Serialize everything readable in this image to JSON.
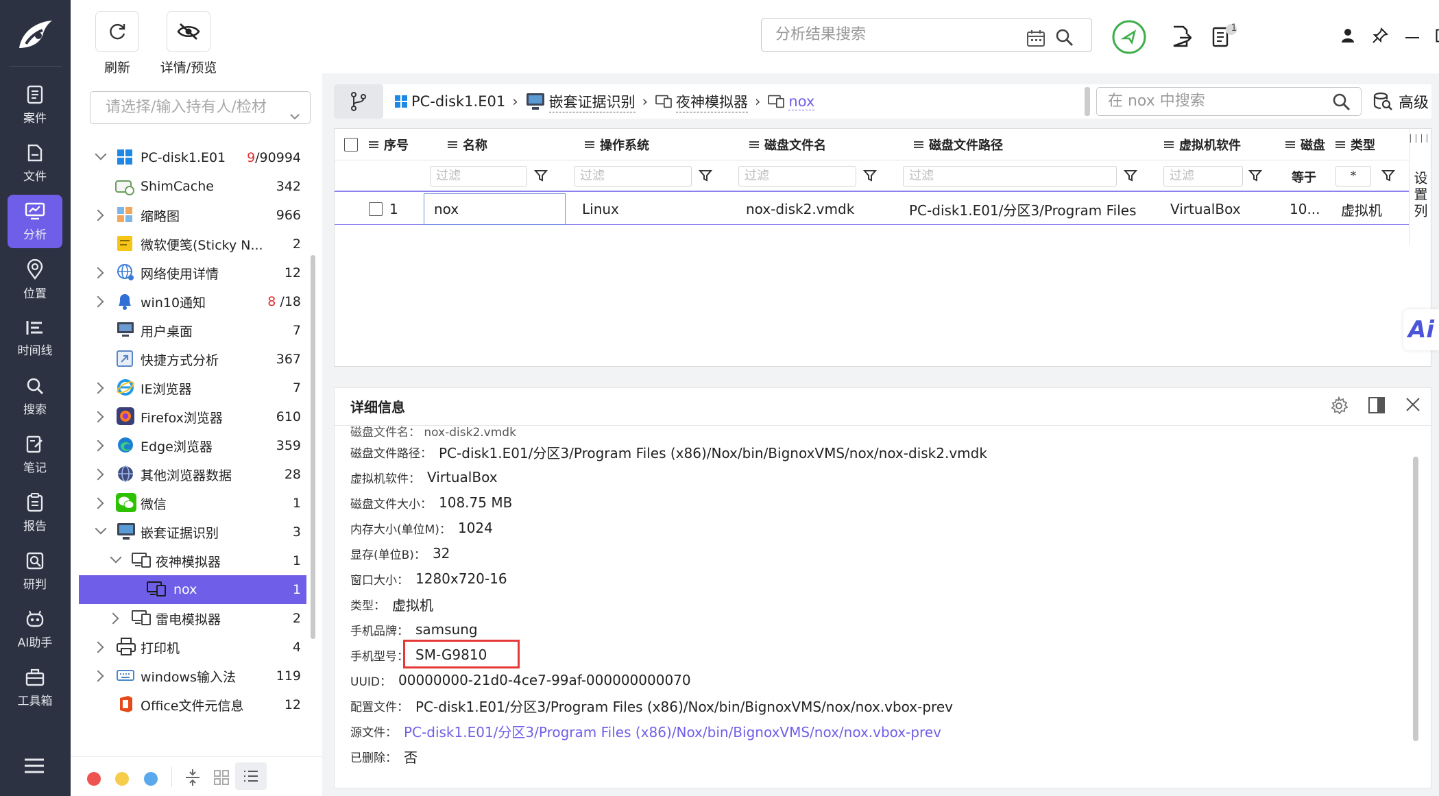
{
  "rail": {
    "items": [
      {
        "label": "案件",
        "icon": "document-icon"
      },
      {
        "label": "文件",
        "icon": "file-icon"
      },
      {
        "label": "分析",
        "icon": "monitor-icon"
      },
      {
        "label": "位置",
        "icon": "location-icon"
      },
      {
        "label": "时间线",
        "icon": "timeline-icon"
      },
      {
        "label": "搜索",
        "icon": "search-icon"
      },
      {
        "label": "笔记",
        "icon": "note-icon"
      },
      {
        "label": "报告",
        "icon": "report-icon"
      },
      {
        "label": "研判",
        "icon": "analysis-icon"
      },
      {
        "label": "AI助手",
        "icon": "robot-icon"
      },
      {
        "label": "工具箱",
        "icon": "toolbox-icon"
      }
    ]
  },
  "toolbar": {
    "refresh_label": "刷新",
    "preview_label": "详情/预览",
    "search_placeholder": "分析结果搜索",
    "badge_count": "1"
  },
  "left": {
    "holder_placeholder": "请选择/输入持有人/检材",
    "tree": [
      {
        "label": "PC-disk1.E01",
        "count_red": "9",
        "count": "/90994",
        "icon": "windows-icon"
      },
      {
        "label": "ShimCache",
        "count": "342",
        "icon": "shimcache-icon"
      },
      {
        "label": "缩略图",
        "count": "966",
        "icon": "thumbnail-icon"
      },
      {
        "label": "微软便笺(Sticky N...",
        "count": "2",
        "icon": "sticky-note-icon"
      },
      {
        "label": "网络使用详情",
        "count": "12",
        "icon": "network-icon"
      },
      {
        "label": "win10通知",
        "count_red": "8",
        "count": " /18",
        "icon": "bell-icon"
      },
      {
        "label": "用户桌面",
        "count": "7",
        "icon": "desktop-icon"
      },
      {
        "label": "快捷方式分析",
        "count": "367",
        "icon": "shortcut-icon"
      },
      {
        "label": "IE浏览器",
        "count": "7",
        "icon": "ie-icon"
      },
      {
        "label": "Firefox浏览器",
        "count": "610",
        "icon": "firefox-icon"
      },
      {
        "label": "Edge浏览器",
        "count": "359",
        "icon": "edge-icon"
      },
      {
        "label": "其他浏览器数据",
        "count": "28",
        "icon": "globe-icon"
      },
      {
        "label": "微信",
        "count": "1",
        "icon": "wechat-icon"
      },
      {
        "label": "嵌套证据识别",
        "count": "3",
        "icon": "nested-evidence-icon"
      },
      {
        "label": "夜神模拟器",
        "count": "1",
        "icon": "emulator-icon"
      },
      {
        "label": "nox",
        "count": "1",
        "icon": "vm-icon"
      },
      {
        "label": "雷电模拟器",
        "count": "2",
        "icon": "emulator-icon"
      },
      {
        "label": "打印机",
        "count": "4",
        "icon": "printer-icon"
      },
      {
        "label": "windows输入法",
        "count": "119",
        "icon": "keyboard-icon"
      },
      {
        "label": "Office文件元信息",
        "count": "12",
        "icon": "office-icon"
      }
    ]
  },
  "breadcrumb": {
    "items": [
      "PC-disk1.E01",
      "嵌套证据识别",
      "夜神模拟器",
      "nox"
    ],
    "search_placeholder": "在 nox 中搜索",
    "advanced_label": "高级"
  },
  "grid": {
    "columns": [
      "序号",
      "名称",
      "操作系统",
      "磁盘文件名",
      "磁盘文件路径",
      "虚拟机软件",
      "磁盘",
      "类型"
    ],
    "filter_placeholder": "过滤",
    "filter_equal": "等于",
    "filter_star": "*",
    "settings_label": "设置列",
    "row": {
      "index": "1",
      "name": "nox",
      "os": "Linux",
      "disk_name": "nox-disk2.vmdk",
      "disk_path": "PC-disk1.E01/分区3/Program Files ...",
      "vm_software": "VirtualBox",
      "disk": "10...",
      "type": "虚拟机"
    },
    "ai_label": "Ai"
  },
  "detail": {
    "title": "详细信息",
    "partial_top": "磁盘文件名：  nox-disk2.vmdk",
    "rows": [
      {
        "key": "磁盘文件路径：",
        "value": "PC-disk1.E01/分区3/Program Files (x86)/Nox/bin/BignoxVMS/nox/nox-disk2.vmdk"
      },
      {
        "key": "虚拟机软件：",
        "value": "VirtualBox"
      },
      {
        "key": "磁盘文件大小：",
        "value": "108.75 MB"
      },
      {
        "key": "内存大小(单位M)：",
        "value": "1024"
      },
      {
        "key": "显存(单位B)：",
        "value": "32"
      },
      {
        "key": "窗口大小：",
        "value": "1280x720-16"
      },
      {
        "key": "类型：",
        "value": "虚拟机"
      },
      {
        "key": "手机品牌：",
        "value": "samsung"
      },
      {
        "key": "手机型号：",
        "value": "SM-G9810"
      },
      {
        "key": "UUID：",
        "value": "00000000-21d0-4ce7-99af-000000000070"
      },
      {
        "key": "配置文件：",
        "value": "PC-disk1.E01/分区3/Program Files (x86)/Nox/bin/BignoxVMS/nox/nox.vbox-prev"
      },
      {
        "key": "源文件：",
        "value": "PC-disk1.E01/分区3/Program Files (x86)/Nox/bin/BignoxVMS/nox/nox.vbox-prev"
      },
      {
        "key": "已删除：",
        "value": "否"
      }
    ]
  },
  "colors": {
    "accent": "#6f5ee8",
    "rail": "#2c3241",
    "highlight": "#e53935",
    "red_count": "#e03030"
  }
}
